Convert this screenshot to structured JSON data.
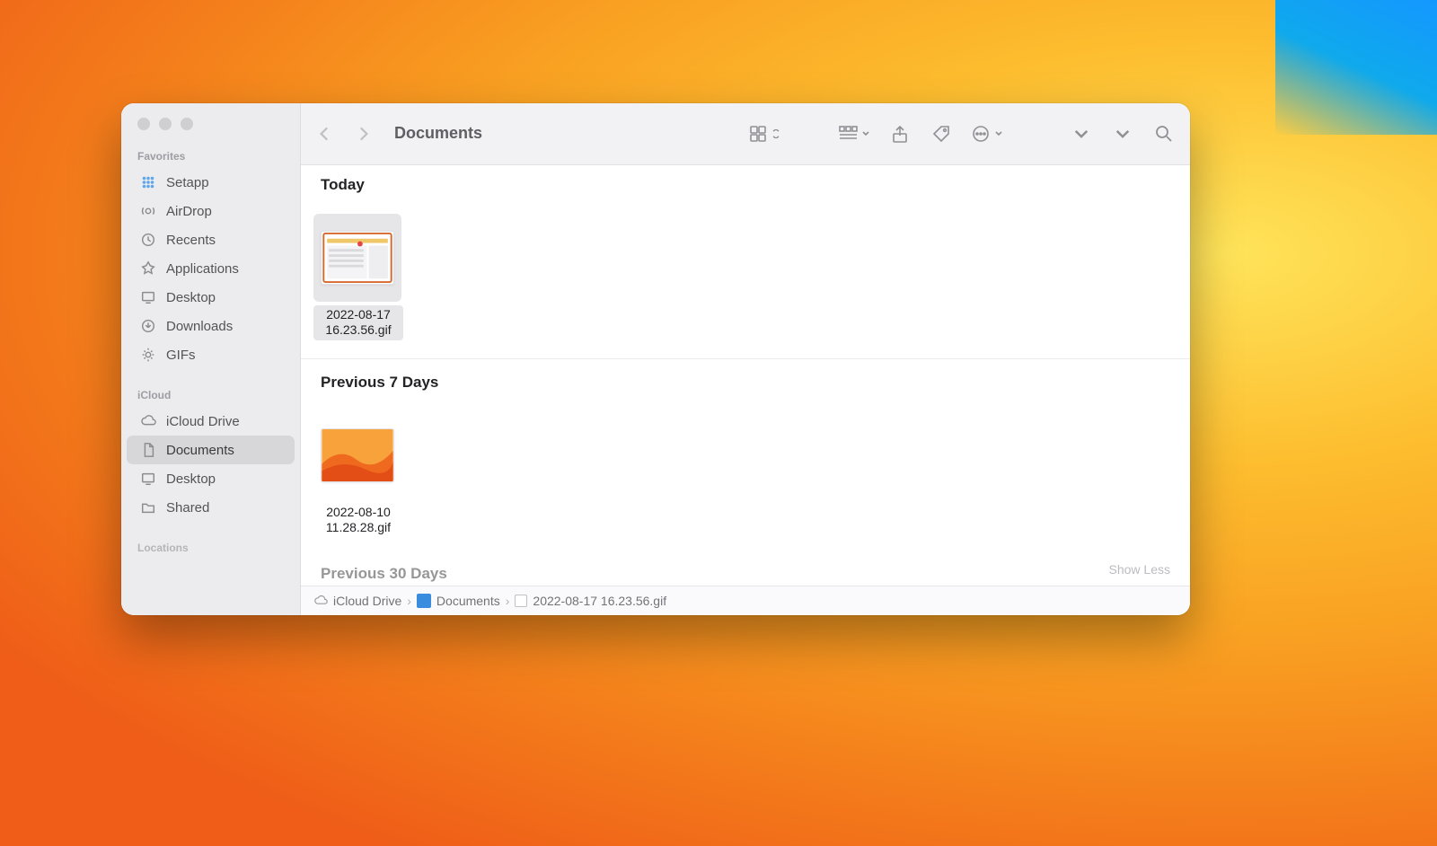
{
  "window": {
    "title": "Documents"
  },
  "sidebar": {
    "sections": [
      {
        "label": "Favorites",
        "items": [
          {
            "label": "Setapp",
            "icon": "app-grid-icon"
          },
          {
            "label": "AirDrop",
            "icon": "airdrop-icon"
          },
          {
            "label": "Recents",
            "icon": "clock-icon"
          },
          {
            "label": "Applications",
            "icon": "applications-icon"
          },
          {
            "label": "Desktop",
            "icon": "desktop-icon"
          },
          {
            "label": "Downloads",
            "icon": "download-icon"
          },
          {
            "label": "GIFs",
            "icon": "gear-icon"
          }
        ]
      },
      {
        "label": "iCloud",
        "items": [
          {
            "label": "iCloud Drive",
            "icon": "cloud-icon"
          },
          {
            "label": "Documents",
            "icon": "document-icon",
            "selected": true
          },
          {
            "label": "Desktop",
            "icon": "desktop-icon"
          },
          {
            "label": "Shared",
            "icon": "shared-folder-icon"
          }
        ]
      }
    ],
    "locations_label": "Locations"
  },
  "toolbar": {
    "icons": [
      "icon-grid-view",
      "group-by",
      "share",
      "tag",
      "more",
      "chevron",
      "chevron",
      "search"
    ]
  },
  "sections": [
    {
      "title": "Today"
    },
    {
      "title": "Previous 7 Days"
    },
    {
      "title": "Previous 30 Days"
    }
  ],
  "files": {
    "today": [
      {
        "name": "2022-08-17 16.23.56.gif",
        "selected": true,
        "thumb": "window"
      }
    ],
    "prev7": [
      {
        "name": "2022-08-10 11.28.28.gif",
        "selected": false,
        "thumb": "wallpaper"
      }
    ]
  },
  "show_less": "Show Less",
  "path": {
    "crumbs": [
      {
        "label": "iCloud Drive",
        "icon": "cloud"
      },
      {
        "label": "Documents",
        "icon": "folder"
      },
      {
        "label": "2022-08-17 16.23.56.gif",
        "icon": "movie"
      }
    ]
  }
}
